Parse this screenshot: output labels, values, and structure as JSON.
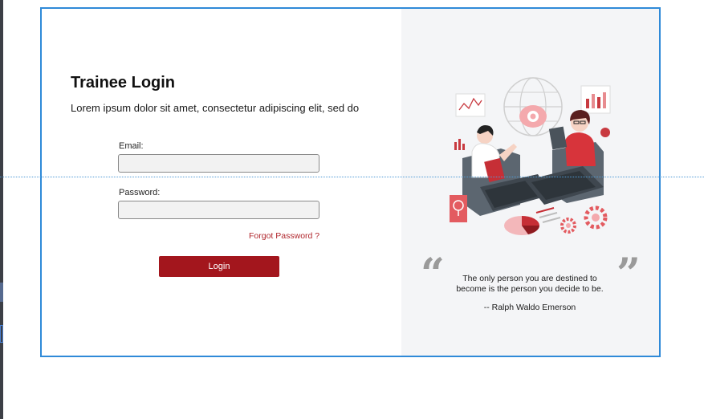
{
  "login": {
    "title": "Trainee Login",
    "subtitle": "Lorem ipsum dolor sit amet, consectetur adipiscing elit, sed do",
    "email_label": "Email:",
    "email_value": "",
    "password_label": "Password:",
    "password_value": "",
    "forgot_link": "Forgot Password ?",
    "login_button": "Login"
  },
  "quote": {
    "open_mark": "“",
    "close_mark": "”",
    "line1": "The only person you are destined to",
    "line2": "become is the person you decide to be.",
    "author": "--  Ralph Waldo Emerson"
  },
  "colors": {
    "accent": "#a3161d",
    "frame_border": "#2f8ad8",
    "right_panel_bg": "#f4f5f7"
  }
}
